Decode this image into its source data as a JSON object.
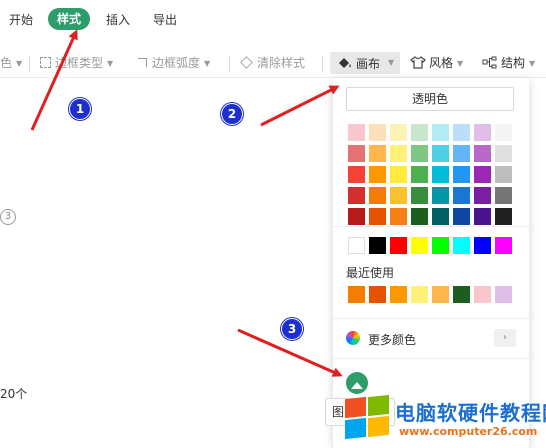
{
  "menu": {
    "tabs": [
      {
        "label": "开始"
      },
      {
        "label": "样式"
      },
      {
        "label": "插入"
      },
      {
        "label": "导出"
      }
    ]
  },
  "toolbar": {
    "color_partial": "色",
    "border_type": "边框类型",
    "border_radius": "边框弧度",
    "clear_style": "清除样式",
    "canvas": "画布",
    "style": "风格",
    "structure": "结构"
  },
  "canvas_dropdown": {
    "transparent_label": "透明色",
    "palette_rows": [
      [
        "#f8c7cc",
        "#fde0b9",
        "#fdf3b7",
        "#c8e6c9",
        "#b2ebf2",
        "#bbdefb",
        "#e1bee7",
        "#f5f5f5"
      ],
      [
        "#e57373",
        "#ffb74d",
        "#fff176",
        "#81c784",
        "#4dd0e1",
        "#64b5f6",
        "#ba68c8",
        "#e0e0e0"
      ],
      [
        "#f44336",
        "#ff9800",
        "#ffeb3b",
        "#4caf50",
        "#00bcd4",
        "#2196f3",
        "#9c27b0",
        "#bdbdbd"
      ],
      [
        "#d32f2f",
        "#f57c00",
        "#fbc02d",
        "#388e3c",
        "#0097a7",
        "#1976d2",
        "#7b1fa2",
        "#757575"
      ],
      [
        "#b71c1c",
        "#e65100",
        "#f57f17",
        "#1b5e20",
        "#006064",
        "#0d47a1",
        "#4a148c",
        "#212121"
      ]
    ],
    "basic_colors": [
      "#ffffff",
      "#000000",
      "#ff0000",
      "#ffff00",
      "#00ff00",
      "#00ffff",
      "#0000ff",
      "#ff00ff"
    ],
    "recent_label": "最近使用",
    "recent_colors": [
      "#f57c00",
      "#e65100",
      "#ff9800",
      "#fff176",
      "#ffb74d",
      "#1b5e20",
      "#f8c7cc",
      "#e1bee7"
    ],
    "more_colors_label": "更多颜色",
    "image_button_label": "图"
  },
  "page": {
    "left_fragment": "色",
    "circled_marker": "3",
    "count_text": "20个"
  },
  "annotations": {
    "badges": [
      "1",
      "2",
      "3"
    ],
    "arrow_color": "#e02020"
  },
  "watermark": {
    "title": "电脑软硬件教程网",
    "url": "www.computer26.com"
  },
  "colors": {
    "accent": "#2e9c6b",
    "badge": "#1d2fd0"
  }
}
